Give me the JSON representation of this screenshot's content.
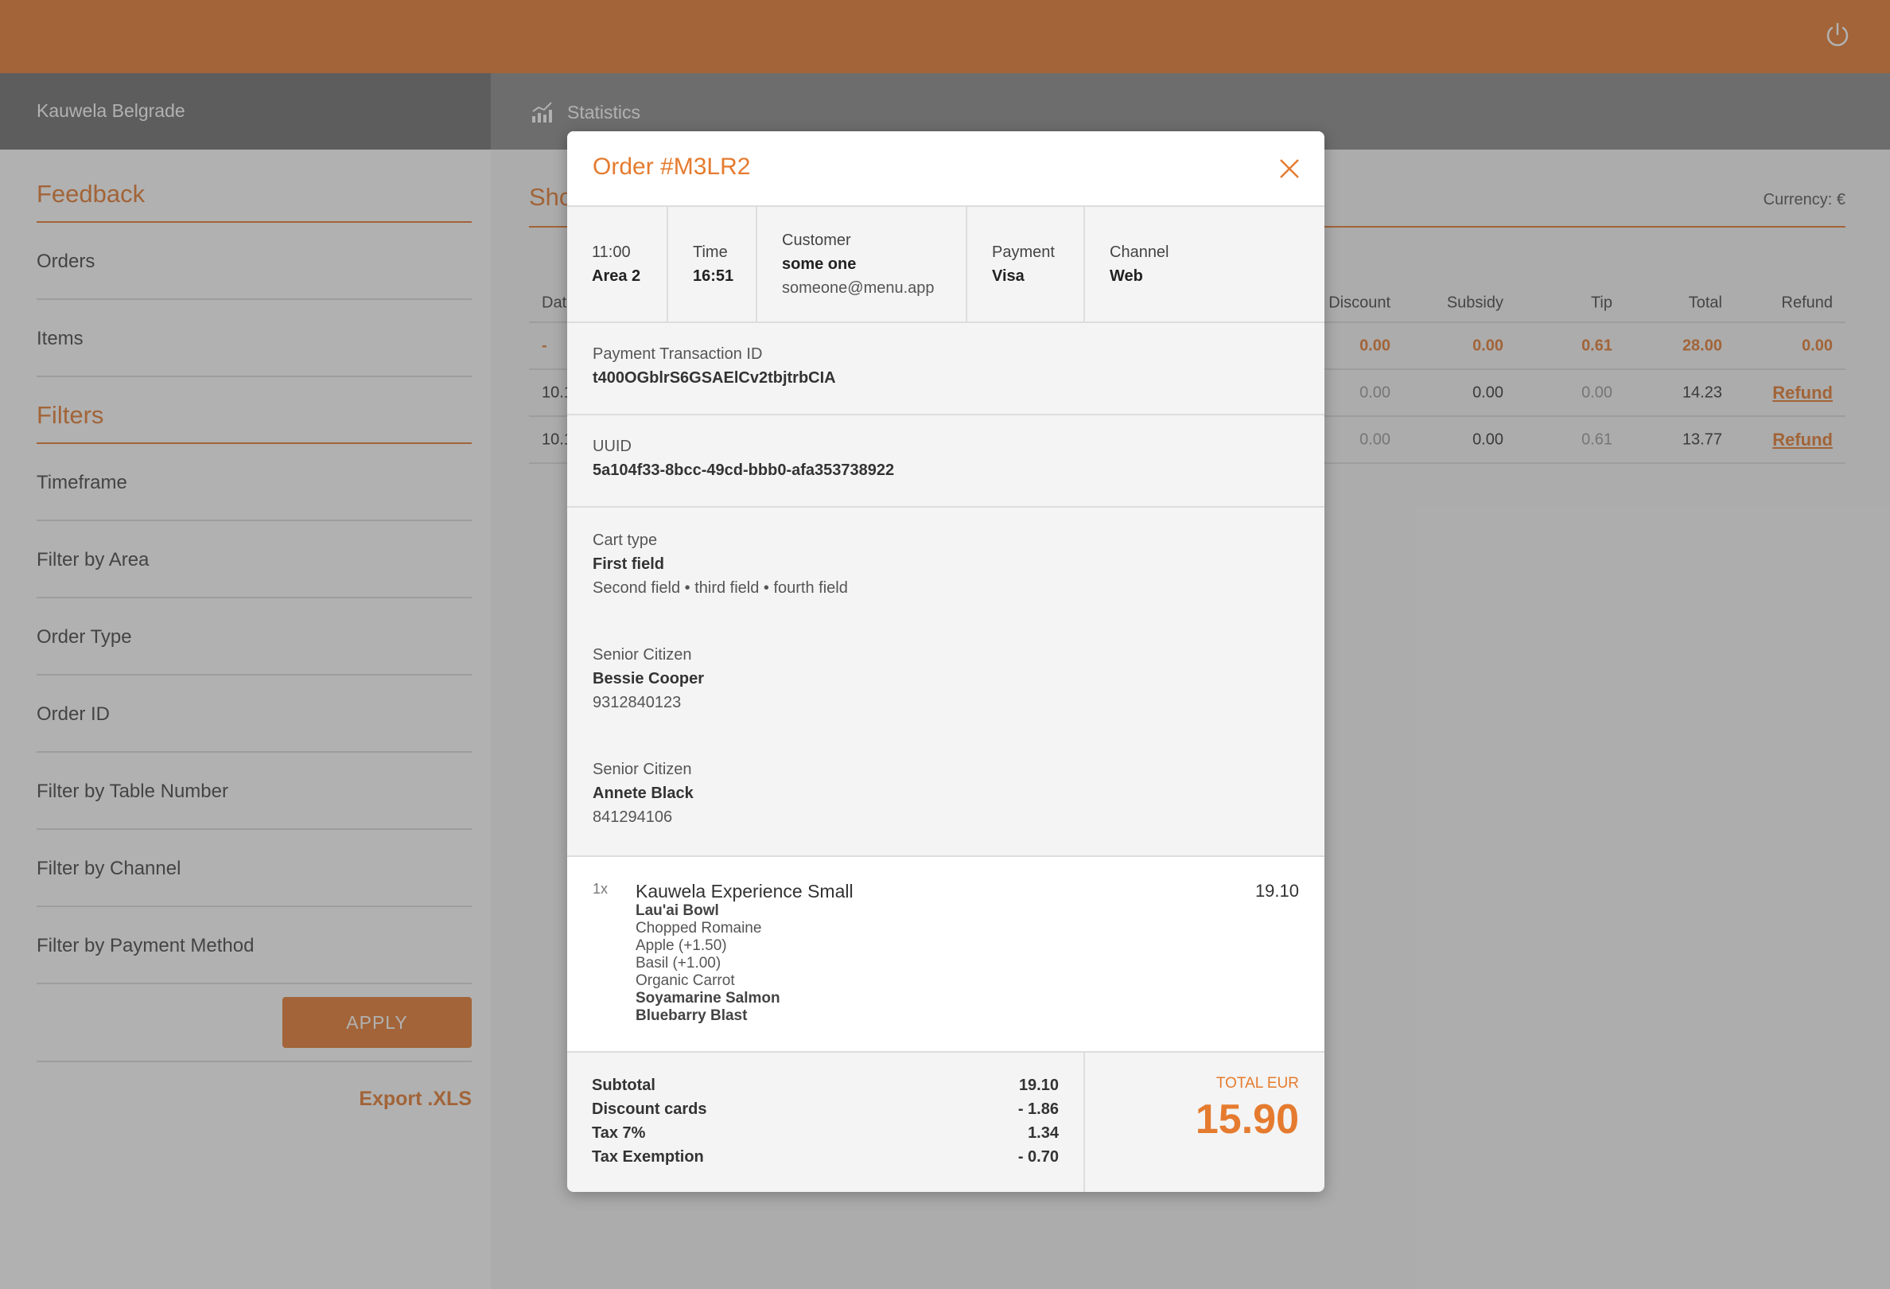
{
  "header": {
    "power_icon": "power-icon"
  },
  "sidebar": {
    "venue": "Kauwela Belgrade",
    "feedback": {
      "title": "Feedback",
      "items": [
        "Orders",
        "Items"
      ]
    },
    "filters": {
      "title": "Filters",
      "items": [
        "Timeframe",
        "Filter by Area",
        "Order Type",
        "Order ID",
        "Filter by Table Number",
        "Filter by Channel",
        "Filter by Payment Method"
      ]
    },
    "apply_label": "APPLY",
    "export_label": "Export .XLS"
  },
  "main": {
    "tab_label": "Statistics",
    "section_title": "Sho",
    "currency": "Currency: €",
    "table": {
      "columns": [
        "Dat",
        "Discount",
        "Subsidy",
        "Tip",
        "Total",
        "Refund"
      ],
      "total_row": [
        "-",
        "0.00",
        "0.00",
        "0.61",
        "28.00",
        "0.00"
      ],
      "rows": [
        [
          "10.1",
          "0.00",
          "0.00",
          "0.00",
          "14.23",
          "Refund"
        ],
        [
          "10.1",
          "0.00",
          "0.00",
          "0.61",
          "13.77",
          "Refund"
        ]
      ]
    }
  },
  "modal": {
    "title": "Order #M3LR2",
    "info": {
      "time_label": "11:00",
      "area": "Area 2",
      "time_col_label": "Time",
      "time_value": "16:51",
      "customer_label": "Customer",
      "customer_name": "some one",
      "customer_email": "someone@menu.app",
      "payment_label": "Payment",
      "payment_value": "Visa",
      "channel_label": "Channel",
      "channel_value": "Web"
    },
    "transaction": {
      "label": "Payment Transaction ID",
      "value": "t400OGblrS6GSAElCv2tbjtrbCIA"
    },
    "uuid": {
      "label": "UUID",
      "value": "5a104f33-8bcc-49cd-bbb0-afa353738922"
    },
    "cart": {
      "label": "Cart type",
      "first": "First field",
      "rest": "Second field • third field • fourth field"
    },
    "seniors": [
      {
        "label": "Senior Citizen",
        "name": "Bessie Cooper",
        "id": "9312840123"
      },
      {
        "label": "Senior Citizen",
        "name": "Annete Black",
        "id": "841294106"
      }
    ],
    "item": {
      "qty": "1x",
      "name": "Kauwela Experience Small",
      "price": "19.10",
      "mods": [
        {
          "text": "Lau'ai Bowl",
          "bold": true
        },
        {
          "text": "Chopped Romaine",
          "bold": false
        },
        {
          "text": "Apple (+1.50)",
          "bold": false
        },
        {
          "text": "Basil (+1.00)",
          "bold": false
        },
        {
          "text": "Organic Carrot",
          "bold": false
        },
        {
          "text": "Soyamarine Salmon",
          "bold": true
        },
        {
          "text": "Bluebarry Blast",
          "bold": true
        }
      ]
    },
    "totals": {
      "lines": [
        {
          "label": "Subtotal",
          "value": "19.10"
        },
        {
          "label": "Discount cards",
          "value": "- 1.86"
        },
        {
          "label": "Tax 7%",
          "value": "1.34"
        },
        {
          "label": "Tax Exemption",
          "value": "- 0.70"
        }
      ],
      "total_label": "TOTAL EUR",
      "total_value": "15.90"
    }
  },
  "colors": {
    "accent": "#e57b2f",
    "overlay": "rgba(70,70,70,0.42)"
  }
}
